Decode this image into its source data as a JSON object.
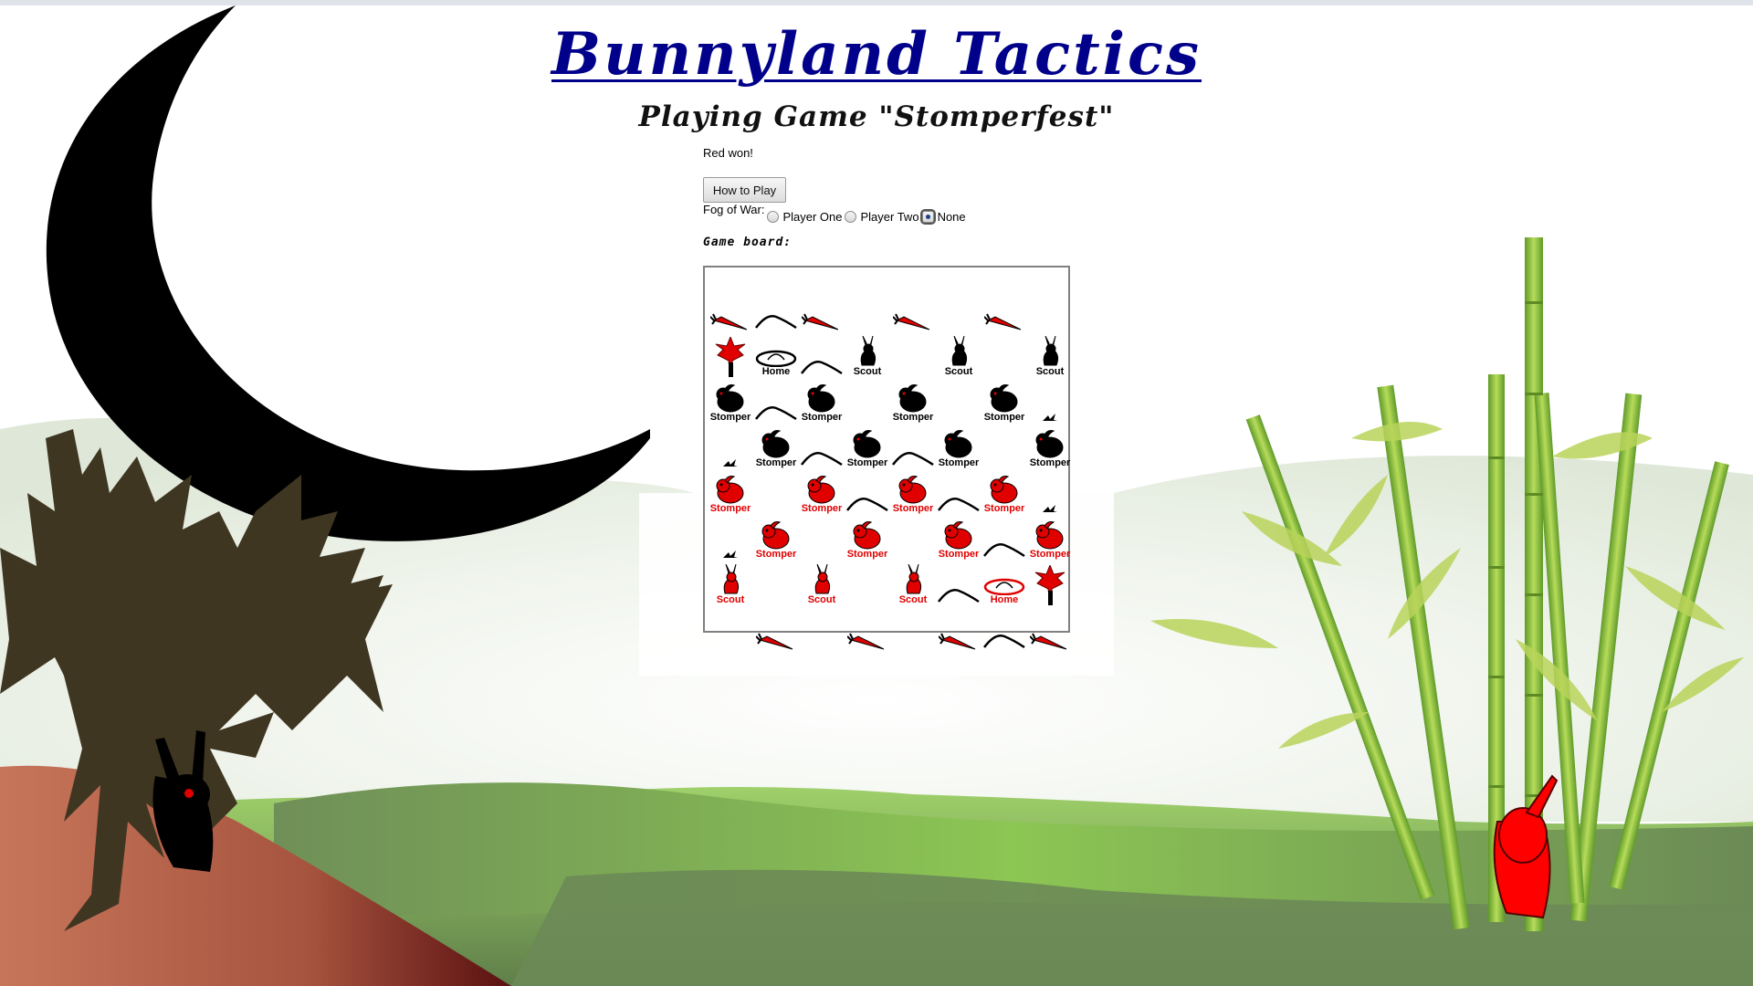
{
  "page": {
    "title": "Bunnyland Tactics",
    "subtitle": "Playing Game \"Stomperfest\"",
    "status": "Red won!",
    "how_to_play": "How to Play",
    "fog_label": "Fog of War:",
    "fog_options": [
      {
        "label": "Player One",
        "checked": false
      },
      {
        "label": "Player Two",
        "checked": false
      },
      {
        "label": "None",
        "checked": true
      }
    ],
    "board_label": "Game board:"
  },
  "colors": {
    "title": "#00008b",
    "red_team": "#e00000",
    "black_team": "#000000",
    "grass_light": "#8cc653",
    "grass_dark": "#5f7f4a",
    "bamboo": "#8fbf3a"
  },
  "board": {
    "rows": 8,
    "cols": 8,
    "cells": [
      [
        {
          "t": "carrot"
        },
        {
          "t": "hill"
        },
        {
          "t": "carrot"
        },
        {
          "t": "empty"
        },
        {
          "t": "carrot"
        },
        {
          "t": "empty"
        },
        {
          "t": "carrot"
        },
        {
          "t": "empty"
        }
      ],
      [
        {
          "t": "tree"
        },
        {
          "t": "home",
          "team": "black",
          "label": "Home"
        },
        {
          "t": "hill"
        },
        {
          "t": "scout",
          "team": "black",
          "label": "Scout"
        },
        {
          "t": "empty"
        },
        {
          "t": "scout",
          "team": "black",
          "label": "Scout"
        },
        {
          "t": "empty"
        },
        {
          "t": "scout",
          "team": "black",
          "label": "Scout"
        }
      ],
      [
        {
          "t": "stomper",
          "team": "black",
          "label": "Stomper"
        },
        {
          "t": "hill"
        },
        {
          "t": "stomper",
          "team": "black",
          "label": "Stomper"
        },
        {
          "t": "empty"
        },
        {
          "t": "stomper",
          "team": "black",
          "label": "Stomper"
        },
        {
          "t": "empty"
        },
        {
          "t": "stomper",
          "team": "black",
          "label": "Stomper"
        },
        {
          "t": "grass"
        }
      ],
      [
        {
          "t": "grass"
        },
        {
          "t": "stomper",
          "team": "black",
          "label": "Stomper"
        },
        {
          "t": "hill"
        },
        {
          "t": "stomper",
          "team": "black",
          "label": "Stomper"
        },
        {
          "t": "hill"
        },
        {
          "t": "stomper",
          "team": "black",
          "label": "Stomper"
        },
        {
          "t": "empty"
        },
        {
          "t": "stomper",
          "team": "black",
          "label": "Stomper"
        }
      ],
      [
        {
          "t": "stomper",
          "team": "red",
          "label": "Stomper"
        },
        {
          "t": "empty"
        },
        {
          "t": "stomper",
          "team": "red",
          "label": "Stomper"
        },
        {
          "t": "hill"
        },
        {
          "t": "stomper",
          "team": "red",
          "label": "Stomper"
        },
        {
          "t": "hill"
        },
        {
          "t": "stomper",
          "team": "red",
          "label": "Stomper"
        },
        {
          "t": "grass"
        }
      ],
      [
        {
          "t": "grass"
        },
        {
          "t": "stomper",
          "team": "red",
          "label": "Stomper"
        },
        {
          "t": "empty"
        },
        {
          "t": "stomper",
          "team": "red",
          "label": "Stomper"
        },
        {
          "t": "empty"
        },
        {
          "t": "stomper",
          "team": "red",
          "label": "Stomper"
        },
        {
          "t": "hill"
        },
        {
          "t": "stomper",
          "team": "red",
          "label": "Stomper"
        }
      ],
      [
        {
          "t": "scout",
          "team": "red",
          "label": "Scout"
        },
        {
          "t": "empty"
        },
        {
          "t": "scout",
          "team": "red",
          "label": "Scout"
        },
        {
          "t": "empty"
        },
        {
          "t": "scout",
          "team": "red",
          "label": "Scout"
        },
        {
          "t": "hill"
        },
        {
          "t": "home",
          "team": "red",
          "label": "Home"
        },
        {
          "t": "tree"
        }
      ],
      [
        {
          "t": "empty"
        },
        {
          "t": "carrot"
        },
        {
          "t": "empty"
        },
        {
          "t": "carrot"
        },
        {
          "t": "empty"
        },
        {
          "t": "carrot"
        },
        {
          "t": "hill"
        },
        {
          "t": "carrot"
        }
      ]
    ]
  }
}
